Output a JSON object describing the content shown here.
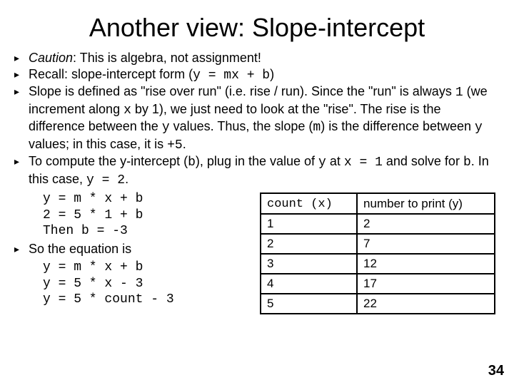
{
  "title": "Another view: Slope-intercept",
  "bullets": {
    "b1_pre": "Caution",
    "b1_post": ": This is algebra, not assignment!",
    "b2_pre": "Recall: slope-intercept form (",
    "b2_code": "y = mx + b",
    "b2_post": ")",
    "b3_a": "Slope is defined as \"rise over run\" (i.e. rise / run).  Since the \"run\" is always ",
    "b3_b": "1",
    "b3_c": " (we increment along ",
    "b3_d": "x",
    "b3_e": " by 1), we just need to look at the \"rise\".  The rise is the difference between the ",
    "b3_f": "y",
    "b3_g": " values.  Thus, the slope (",
    "b3_h": "m",
    "b3_i": ") is the difference between ",
    "b3_j": "y",
    "b3_k": " values; in this case, it is ",
    "b3_l": "+5",
    "b3_m": ".",
    "b4_a": "To compute the y-intercept (",
    "b4_b": "b",
    "b4_c": "), plug in the value of ",
    "b4_d": "y",
    "b4_e": " at ",
    "b4_f": "x = 1",
    "b4_g": " and solve for ",
    "b4_h": "b",
    "b4_i": ".  In this case, ",
    "b4_j": "y = 2",
    "b4_k": ".",
    "b5": "So the equation is"
  },
  "code1": "y = m * x + b\n2 = 5 * 1 + b\nThen b = -3",
  "code2": "y = m * x + b\ny = 5 * x - 3\ny = 5 * count - 3",
  "table": {
    "h1": "count (x)",
    "h2": "number to print (y)",
    "rows": [
      {
        "c1": "1",
        "c2": "2"
      },
      {
        "c1": "2",
        "c2": "7"
      },
      {
        "c1": "3",
        "c2": "12"
      },
      {
        "c1": "4",
        "c2": "17"
      },
      {
        "c1": "5",
        "c2": "22"
      }
    ]
  },
  "pagenum": "34",
  "marker": "▸"
}
